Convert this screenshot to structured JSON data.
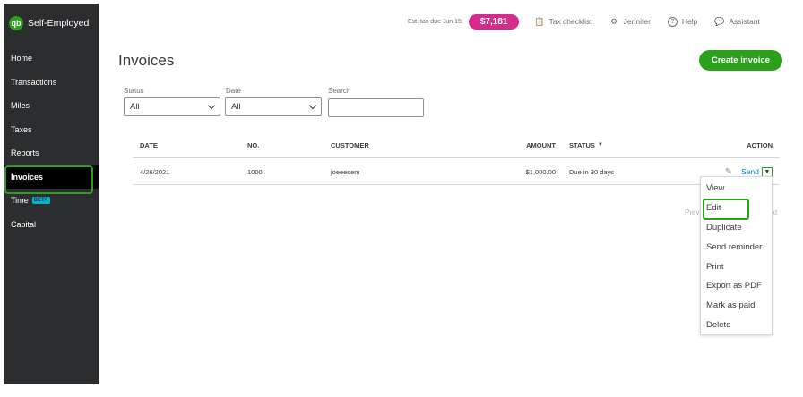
{
  "app": {
    "name": "Self-Employed",
    "logo_text": "qb"
  },
  "topbar": {
    "est_tax_label": "Est. tax due Jun 15:",
    "est_tax_amount": "$7,181",
    "tax_checklist": "Tax checklist",
    "user": "Jennifer",
    "help": "Help",
    "assistant": "Assistant"
  },
  "sidebar": {
    "items": [
      {
        "label": "Home"
      },
      {
        "label": "Transactions"
      },
      {
        "label": "Miles"
      },
      {
        "label": "Taxes"
      },
      {
        "label": "Reports"
      },
      {
        "label": "Invoices",
        "active": true
      },
      {
        "label": "Time",
        "badge": "BETA"
      },
      {
        "label": "Capital"
      }
    ]
  },
  "page": {
    "title": "Invoices",
    "create_button": "Create invoice"
  },
  "filters": {
    "status_label": "Status",
    "status_value": "All",
    "date_label": "Date",
    "date_value": "All",
    "search_label": "Search",
    "search_placeholder": ""
  },
  "table": {
    "headers": {
      "date": "DATE",
      "no": "NO.",
      "customer": "CUSTOMER",
      "amount": "AMOUNT",
      "status": "STATUS",
      "action": "ACTION"
    },
    "rows": [
      {
        "date": "4/26/2021",
        "no": "1000",
        "customer": "joeeesem",
        "amount": "$1,000.00",
        "status": "Due in 30 days",
        "action": "Send"
      }
    ]
  },
  "pager": {
    "prev": "Prev",
    "next": "xt"
  },
  "action_menu": {
    "items": [
      "View",
      "Edit",
      "Duplicate",
      "Send reminder",
      "Print",
      "Export as PDF",
      "Mark as paid",
      "Delete"
    ]
  },
  "colors": {
    "brand_green": "#2ca01c",
    "tax_badge": "#d52b8a",
    "sidebar_bg": "#2c2d2f",
    "link_blue": "#0077c5"
  }
}
